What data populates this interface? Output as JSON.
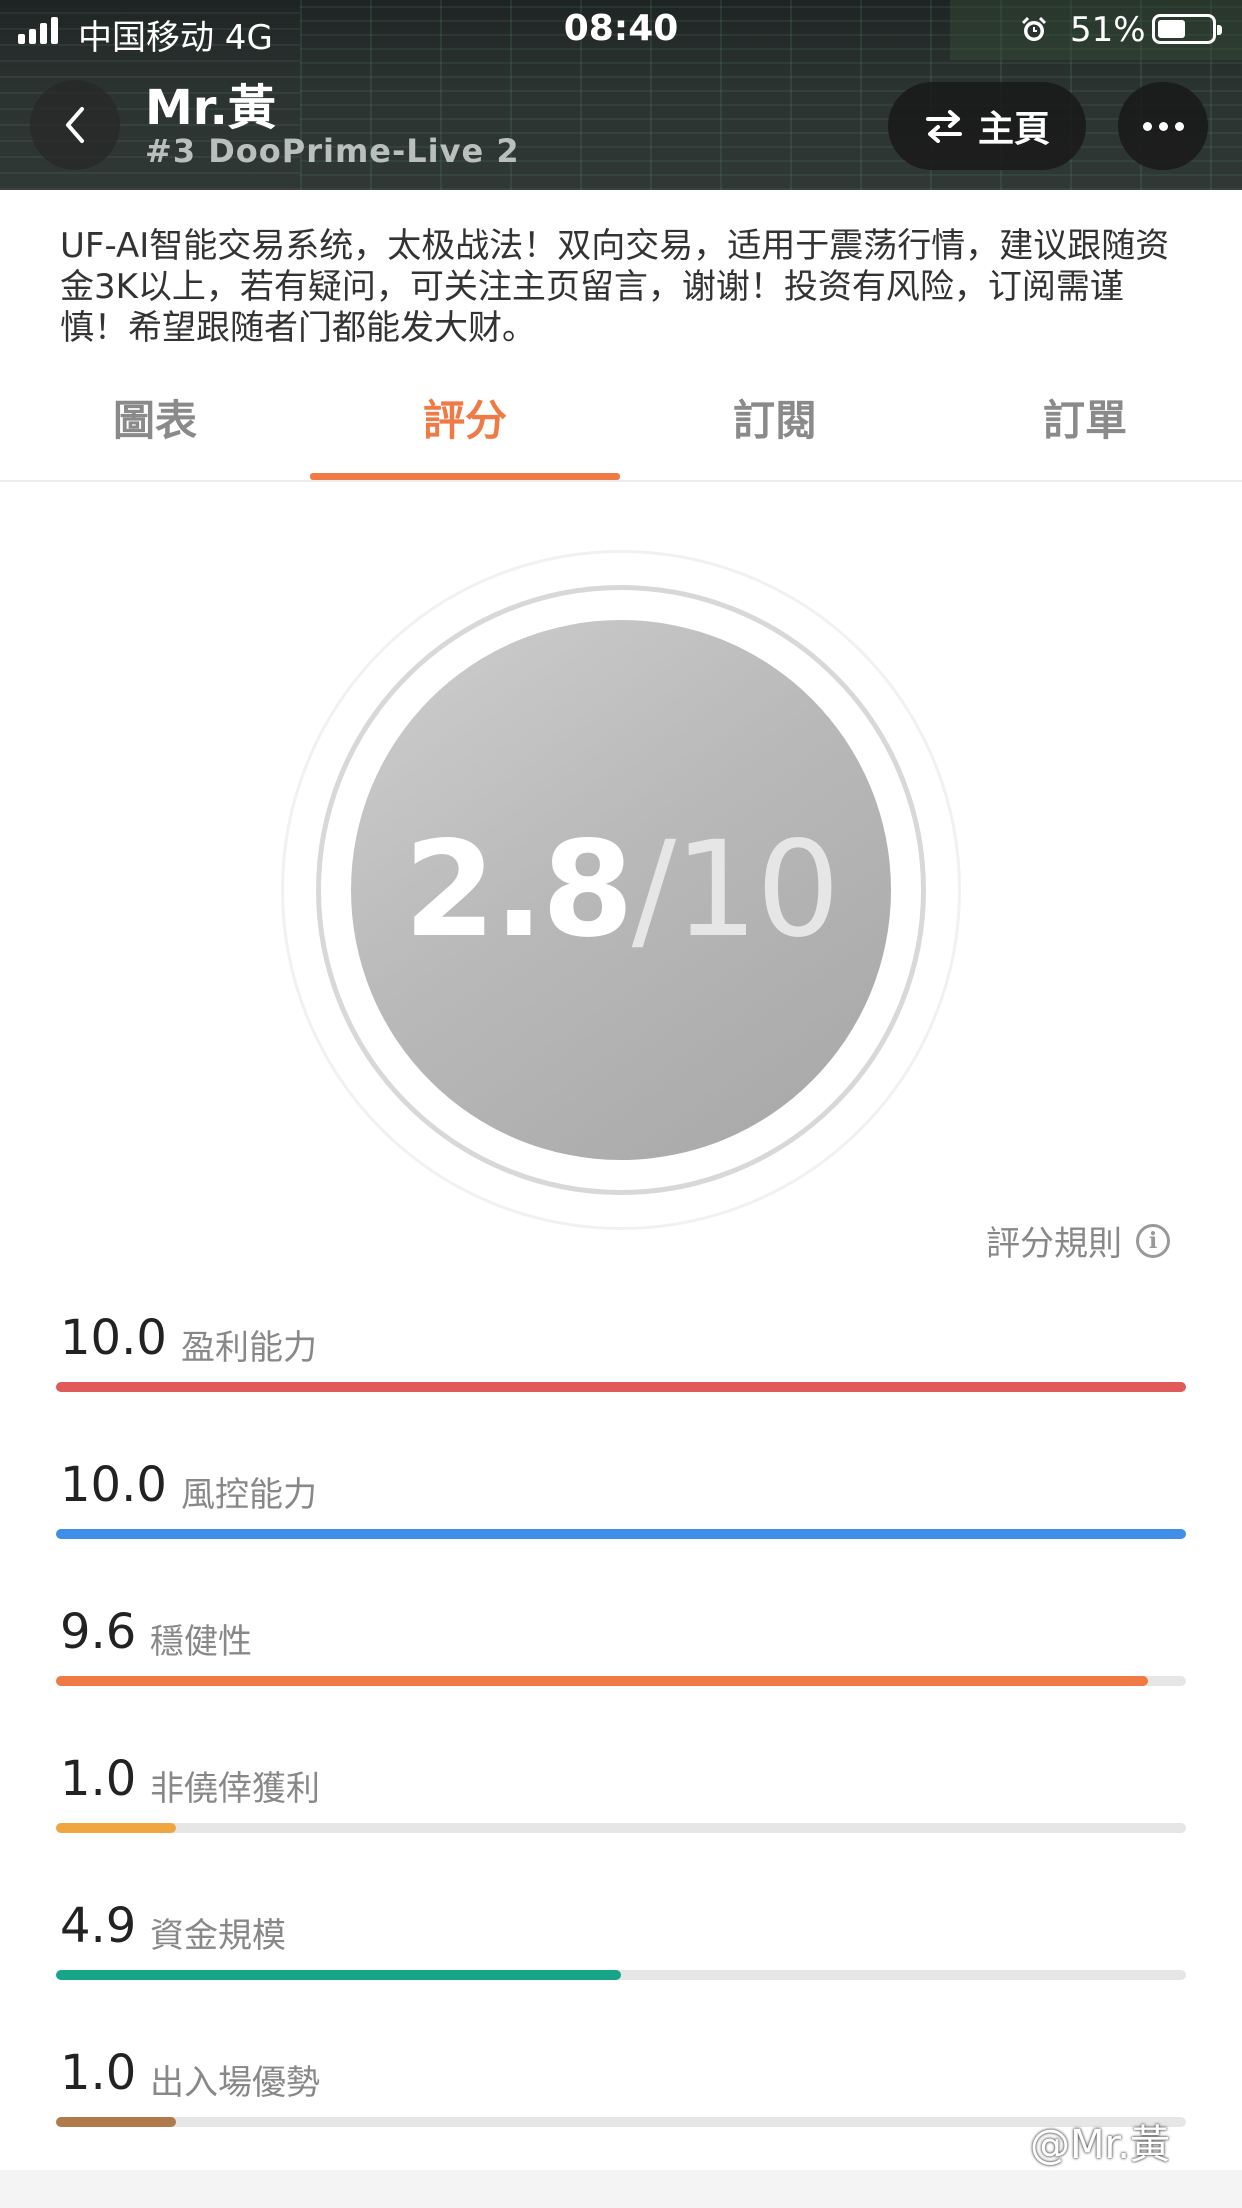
{
  "status_bar": {
    "carrier": "中国移动  4G",
    "time": "08:40",
    "battery": "51%",
    "battery_level": 0.51
  },
  "header": {
    "user_name": "Mr.黃",
    "account": "#3 DooPrime-Live 2",
    "home_label": "主頁",
    "icons": {
      "back": "chevron-left-icon",
      "home": "swap-arrows-icon",
      "more": "more-dots-icon"
    }
  },
  "description": "UF-AI智能交易系统，太极战法！双向交易，适用于震荡行情，建议跟随资金3K以上，若有疑问，可关注主页留言，谢谢！投资有风险，订阅需谨慎！希望跟随者门都能发大财。",
  "tabs": [
    {
      "label": "圖表",
      "active": false
    },
    {
      "label": "評分",
      "active": true
    },
    {
      "label": "訂閱",
      "active": false
    },
    {
      "label": "訂單",
      "active": false
    }
  ],
  "score": {
    "value": "2.8",
    "max": "/10"
  },
  "rules_label": "評分規則",
  "metrics": [
    {
      "value": "10.0",
      "label": "盈利能力",
      "level": 1.0,
      "color": "#e05a5a"
    },
    {
      "value": "10.0",
      "label": "風控能力",
      "level": 1.0,
      "color": "#3f8fe8"
    },
    {
      "value": "9.6",
      "label": "穩健性",
      "level": 0.966,
      "color": "#ef7a46"
    },
    {
      "value": "1.0",
      "label": "非僥倖獲利",
      "level": 0.106,
      "color": "#f0a640"
    },
    {
      "value": "4.9",
      "label": "資金規模",
      "level": 0.5,
      "color": "#17a58a"
    },
    {
      "value": "1.0",
      "label": "出入場優勢",
      "level": 0.106,
      "color": "#b07a4c"
    }
  ],
  "accent_color": "#ef7a46",
  "watermark": "@Mr.黃"
}
